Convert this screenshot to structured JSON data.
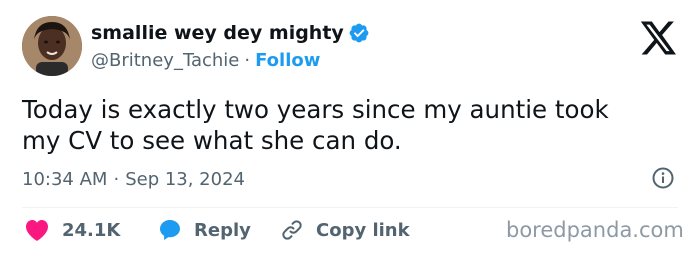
{
  "author": {
    "display_name": "smallie wey dey mighty",
    "handle": "@Britney_Tachie",
    "separator": "·",
    "follow_label": "Follow"
  },
  "tweet": {
    "lines": [
      "Today is exactly two years since my auntie took",
      "my CV to see what she can do."
    ],
    "time": "10:34 AM",
    "separator": "·",
    "date": "Sep 13, 2024"
  },
  "actions": {
    "like_count": "24.1K",
    "reply_label": "Reply",
    "copy_link_label": "Copy link"
  },
  "watermark": "boredpanda.com",
  "colors": {
    "accent": "#1d9bf0",
    "like": "#f91880",
    "secondary_text": "#536471"
  },
  "icons": [
    "avatar",
    "verified-badge-icon",
    "x-logo-icon",
    "info-icon",
    "heart-icon",
    "reply-bubble-icon",
    "link-icon"
  ]
}
